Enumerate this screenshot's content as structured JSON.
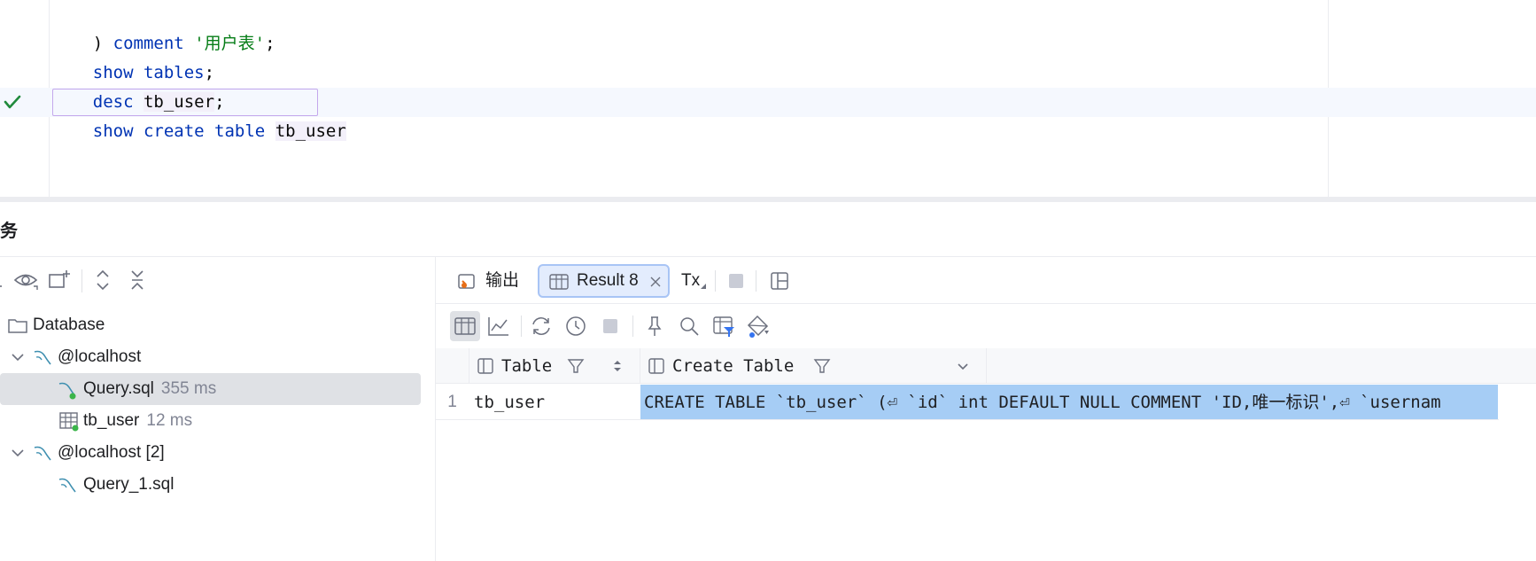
{
  "editor": {
    "lines": [
      {
        "parts": [
          {
            "t": ") ",
            "c": "plain"
          },
          {
            "t": "comment",
            "c": "kw"
          },
          {
            "t": " ",
            "c": "plain"
          },
          {
            "t": "'用户表'",
            "c": "str"
          },
          {
            "t": ";",
            "c": "plain"
          }
        ]
      },
      {
        "parts": [
          {
            "t": "show tables",
            "c": "kw"
          },
          {
            "t": ";",
            "c": "plain"
          }
        ]
      },
      {
        "parts": [
          {
            "t": "desc",
            "c": "kw"
          },
          {
            "t": " ",
            "c": "plain"
          },
          {
            "t": "tb_user",
            "c": "id"
          },
          {
            "t": ";",
            "c": "plain"
          }
        ]
      },
      {
        "parts": [
          {
            "t": "show create table",
            "c": "kw"
          },
          {
            "t": " ",
            "c": "plain"
          },
          {
            "t": "tb_user",
            "c": "id"
          }
        ]
      }
    ],
    "check_icon": "checkmark-icon"
  },
  "services": {
    "title": "务",
    "toolbar_icons": [
      "eye-icon",
      "add-tab-icon",
      "expand-all-icon",
      "collapse-all-icon"
    ],
    "tree": {
      "database": "Database",
      "host1": "@localhost",
      "query1": {
        "name": "Query.sql",
        "time": "355 ms"
      },
      "table1": {
        "name": "tb_user",
        "time": "12 ms"
      },
      "host2": "@localhost [2]",
      "query2": {
        "name": "Query_1.sql"
      }
    }
  },
  "results": {
    "tabs": {
      "output": "输出",
      "result": "Result 8",
      "tx": "Tx"
    },
    "grid": {
      "columns": [
        "Table",
        "Create Table"
      ],
      "rows": [
        {
          "num": "1",
          "table": "tb_user",
          "create": "CREATE TABLE `tb_user` (⏎  `id` int DEFAULT NULL COMMENT 'ID,唯一标识',⏎  `usernam"
        }
      ]
    }
  },
  "colors": {
    "keyword": "#0033b3",
    "string": "#067d17",
    "selection": "#a6cdf5",
    "active_tab": "#e3ecfd"
  }
}
